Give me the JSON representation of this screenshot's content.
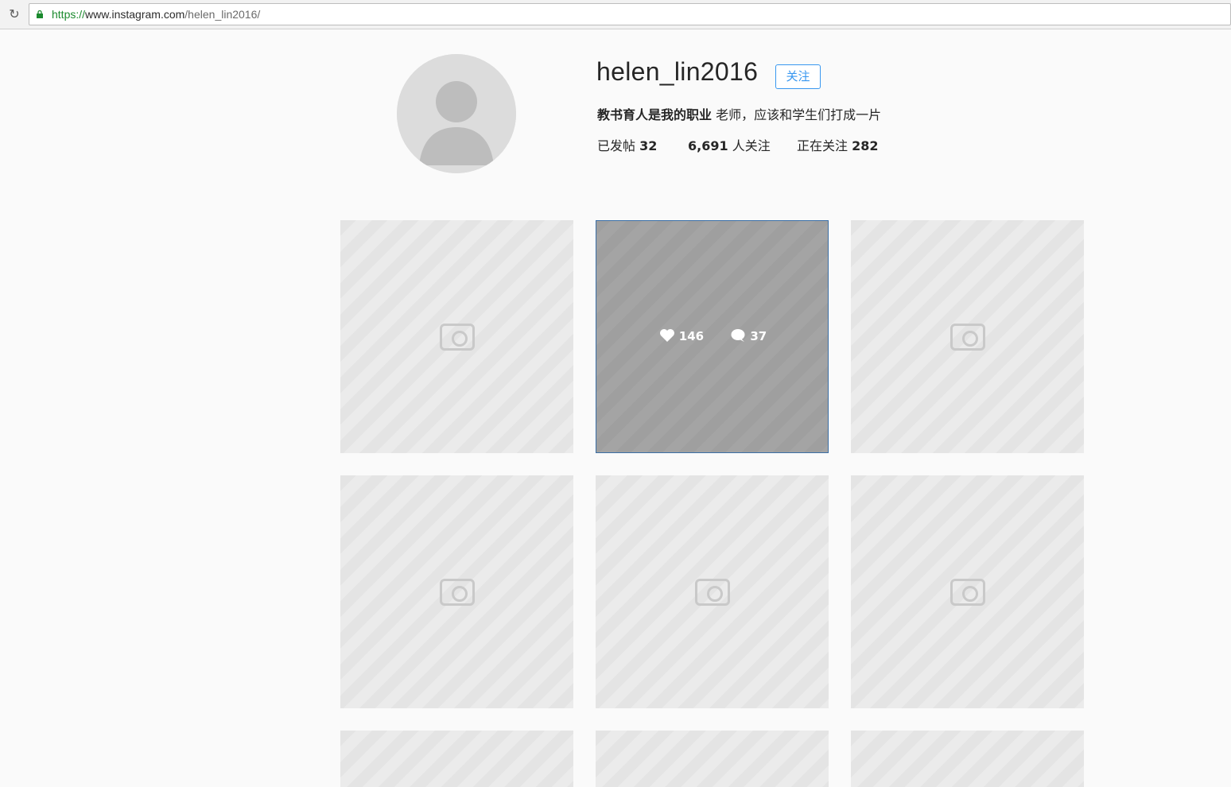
{
  "browser": {
    "url_scheme": "https://",
    "url_host": "www.instagram.com",
    "url_path": "/helen_lin2016/"
  },
  "profile": {
    "username": "helen_lin2016",
    "follow_label": "关注",
    "bio_name": "教书育人是我的职业",
    "bio_text": " 老师，应该和学生们打成一片",
    "stats": {
      "posts_label": "已发帖 ",
      "posts_count": "32",
      "followers_count": "6,691",
      "followers_label": " 人关注",
      "following_label": "正在关注 ",
      "following_count": "282"
    }
  },
  "grid": {
    "hover_likes": "146",
    "hover_comments": "37"
  },
  "colors": {
    "accent": "#3897f0",
    "secure": "#1b8a2e"
  }
}
